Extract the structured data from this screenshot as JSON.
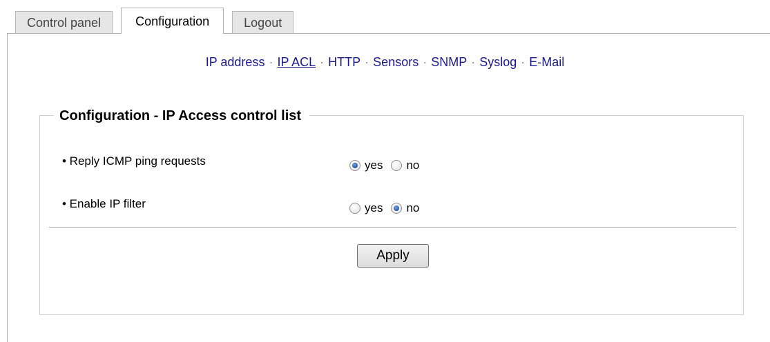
{
  "tabs": [
    {
      "label": "Control panel",
      "active": false
    },
    {
      "label": "Configuration",
      "active": true
    },
    {
      "label": "Logout",
      "active": false
    }
  ],
  "subnav": {
    "items": [
      "IP address",
      "IP ACL",
      "HTTP",
      "Sensors",
      "SNMP",
      "Syslog",
      "E-Mail"
    ],
    "current": "IP ACL",
    "separator": "·"
  },
  "section": {
    "title": "Configuration - IP Access control list",
    "rows": [
      {
        "label": "• Reply ICMP ping requests",
        "yes_label": "yes",
        "no_label": "no",
        "selected": "yes"
      },
      {
        "label": "• Enable IP filter",
        "yes_label": "yes",
        "no_label": "no",
        "selected": "no"
      }
    ],
    "apply_label": "Apply"
  },
  "colors": {
    "link": "#1a1a8c",
    "tab_inactive_bg": "#e6e6e6",
    "radio_selected": "#1f4f9a"
  }
}
